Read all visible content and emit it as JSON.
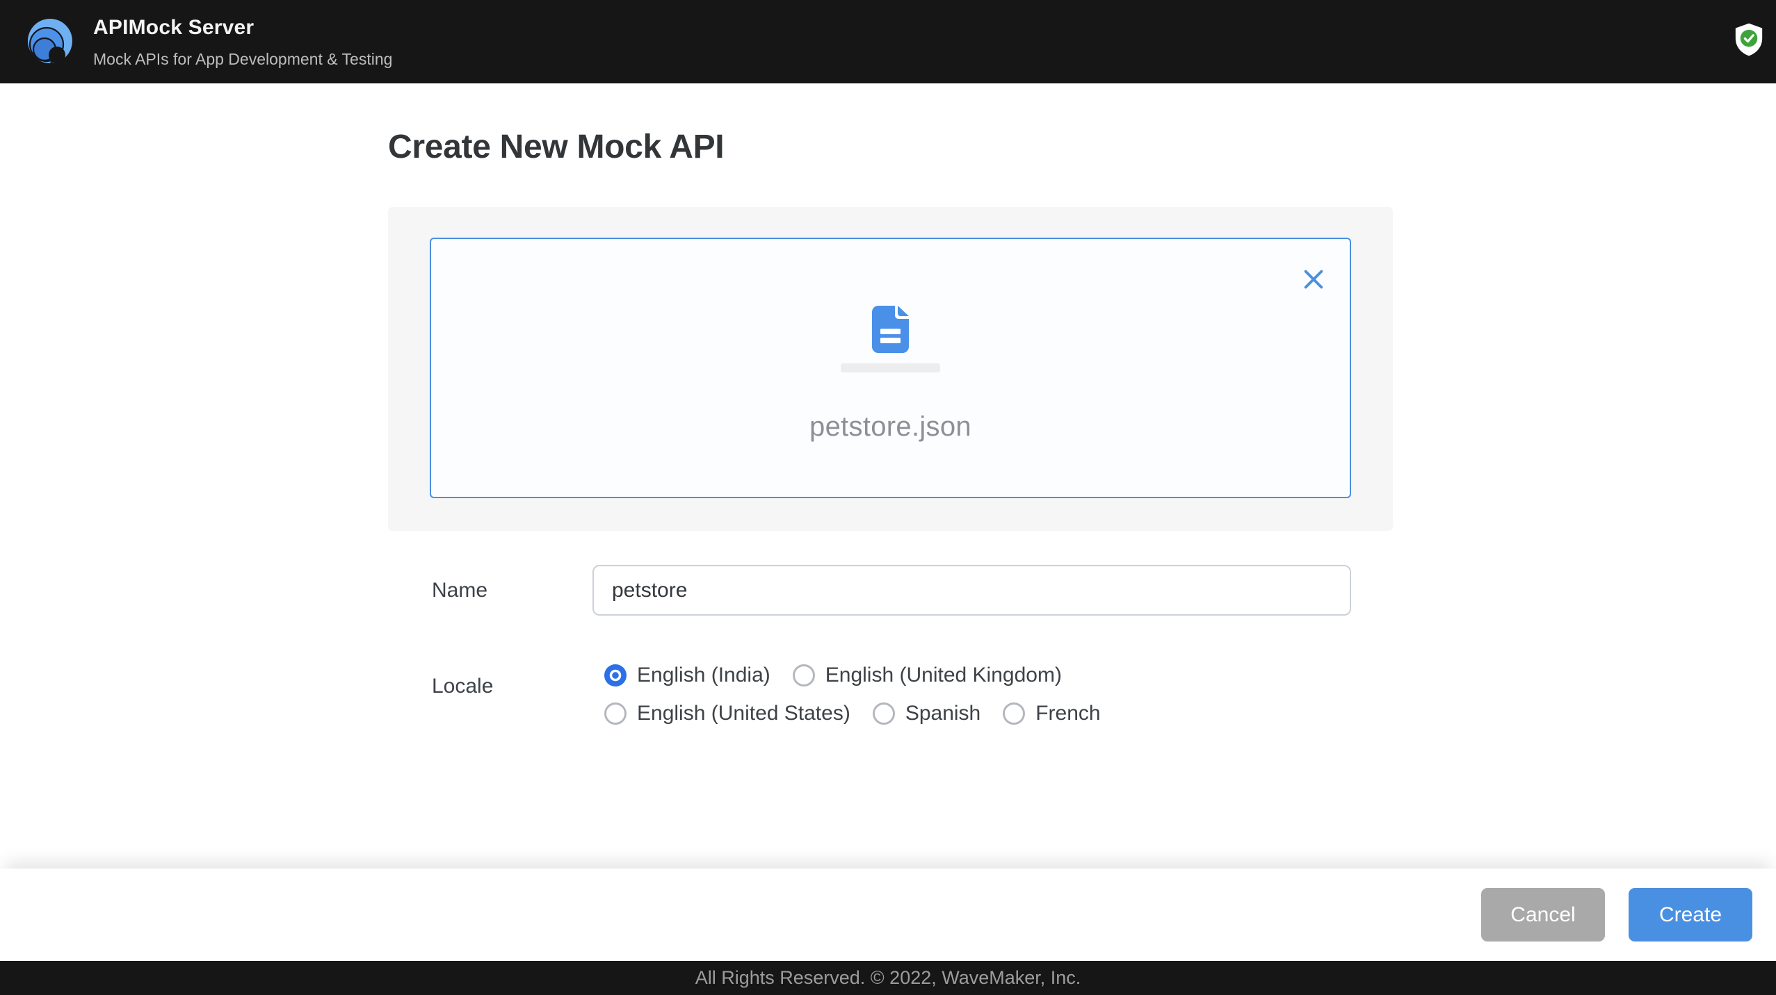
{
  "header": {
    "title": "APIMock Server",
    "subtitle": "Mock APIs for App Development & Testing"
  },
  "page": {
    "heading": "Create New Mock API"
  },
  "upload": {
    "file_name": "petstore.json"
  },
  "form": {
    "name": {
      "label": "Name",
      "value": "petstore"
    },
    "locale": {
      "label": "Locale",
      "options": [
        {
          "label": "English (India)",
          "selected": true
        },
        {
          "label": "English (United Kingdom)",
          "selected": false
        },
        {
          "label": "English (United States)",
          "selected": false
        },
        {
          "label": "Spanish",
          "selected": false
        },
        {
          "label": "French",
          "selected": false
        }
      ]
    }
  },
  "actions": {
    "cancel": "Cancel",
    "create": "Create"
  },
  "footer": {
    "copyright": "All Rights Reserved. © 2022, WaveMaker, Inc."
  },
  "icons": {
    "logo": "wave-logo",
    "shield": "verified-shield",
    "document": "json-file",
    "close": "remove-file"
  },
  "colors": {
    "accent_blue": "#4a90e2",
    "radio_blue": "#2b70e8",
    "success_green": "#3fa33b",
    "header_bg": "#161616",
    "panel_bg": "#f6f6f7",
    "cancel_gray": "#a9a9a9"
  }
}
